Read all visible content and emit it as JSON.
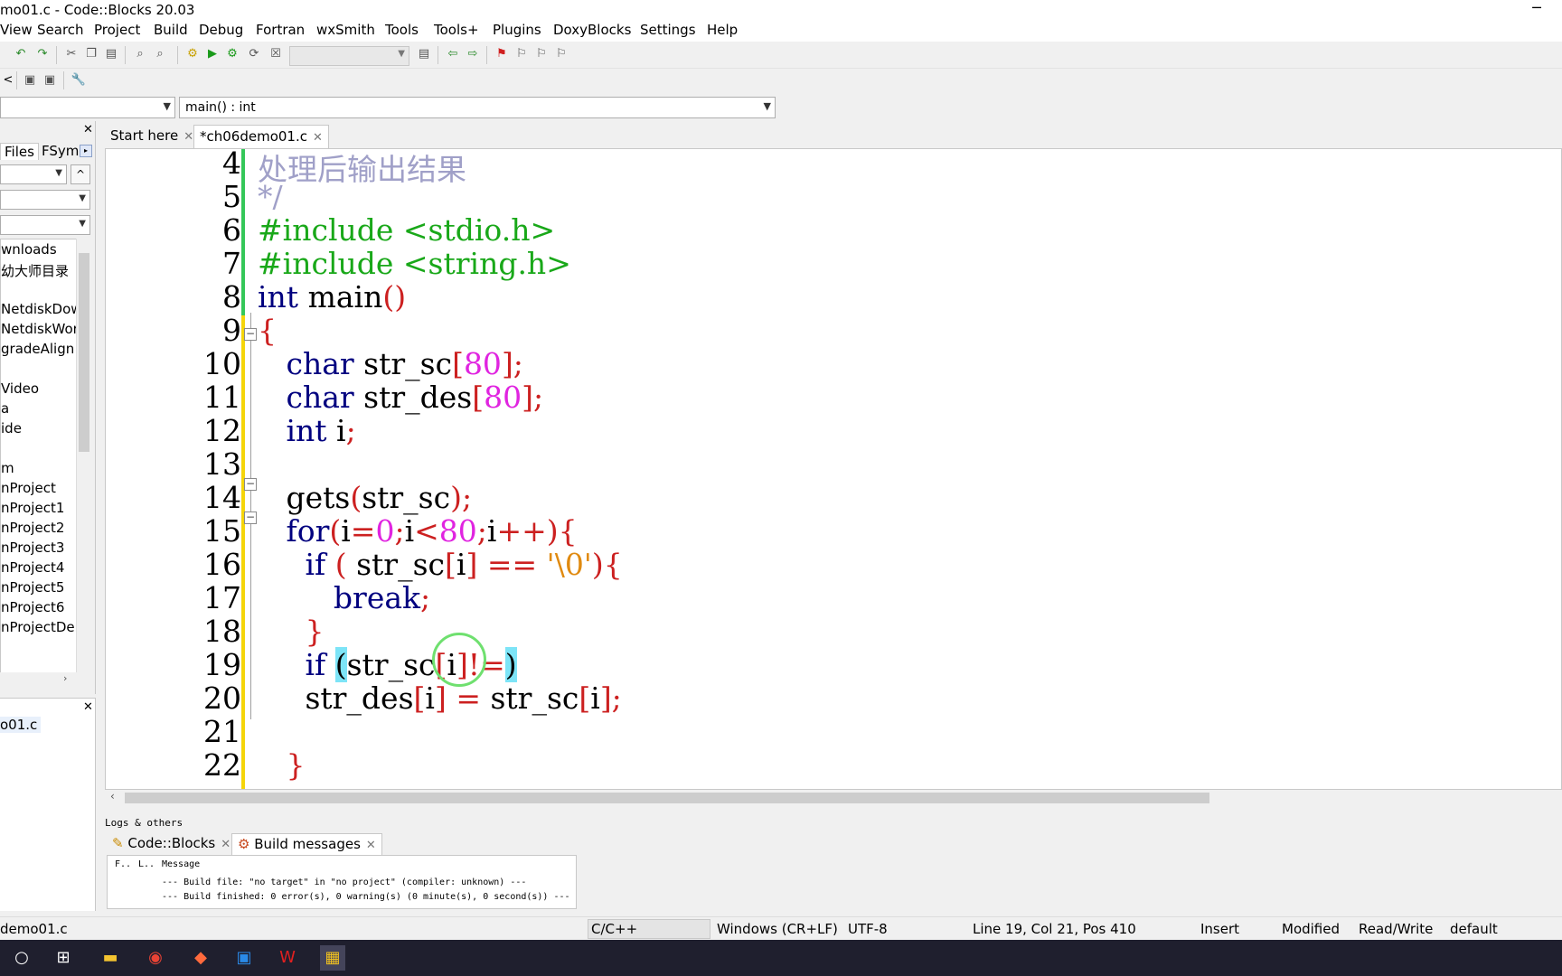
{
  "window": {
    "title": "mo01.c - Code::Blocks 20.03"
  },
  "menu": [
    "View",
    "Search",
    "Project",
    "Build",
    "Debug",
    "Fortran",
    "wxSmith",
    "Tools",
    "Tools+",
    "Plugins",
    "DoxyBlocks",
    "Settings",
    "Help"
  ],
  "codecombo": {
    "function": "main() : int"
  },
  "management": {
    "tabs": [
      "Files",
      "FSymb"
    ],
    "tree": [
      "wnloads",
      "幼大师目录",
      "",
      "NetdiskDow",
      "NetdiskWork",
      "gradeAlign",
      "",
      "Video",
      "a",
      "ide",
      "",
      "m",
      "nProject",
      "nProject1",
      "nProject2",
      "nProject3",
      "nProject4",
      "nProject5",
      "nProject6",
      "nProjectDen"
    ]
  },
  "openfiles": {
    "item": "o01.c"
  },
  "editor": {
    "tabs": [
      "Start here",
      "*ch06demo01.c"
    ],
    "line_numbers": [
      "4",
      "5",
      "6",
      "7",
      "8",
      "9",
      "10",
      "11",
      "12",
      "13",
      "14",
      "15",
      "16",
      "17",
      "18",
      "19",
      "20",
      "21",
      "22"
    ]
  },
  "logs": {
    "caption": "Logs & others",
    "tabs": [
      "Code::Blocks",
      "Build messages"
    ],
    "headers": [
      "F..",
      "L..",
      "Message"
    ],
    "rows": [
      "--- Build file: \"no target\" in \"no project\" (compiler: unknown) ---",
      "--- Build finished: 0 error(s), 0 warning(s) (0 minute(s), 0 second(s)) ---"
    ]
  },
  "status": {
    "file": "demo01.c",
    "language": "C/C++",
    "eol": "Windows (CR+LF)",
    "encoding": "UTF-8",
    "position": "Line 19, Col 21, Pos 410",
    "mode": "Insert",
    "modified": "Modified",
    "access": "Read/Write",
    "profile": "default"
  },
  "icons": [
    "minimize-icon",
    "undo-icon",
    "redo-icon",
    "cut-icon",
    "copy-icon",
    "paste-icon",
    "find-icon",
    "replace-icon",
    "build-icon",
    "run-icon",
    "build-run-icon",
    "rebuild-icon",
    "stop-icon",
    "bookmark-icon",
    "windows-start-icon",
    "task-view-icon",
    "explorer-icon",
    "chrome-icon",
    "app-icon",
    "codeblocks-icon"
  ]
}
